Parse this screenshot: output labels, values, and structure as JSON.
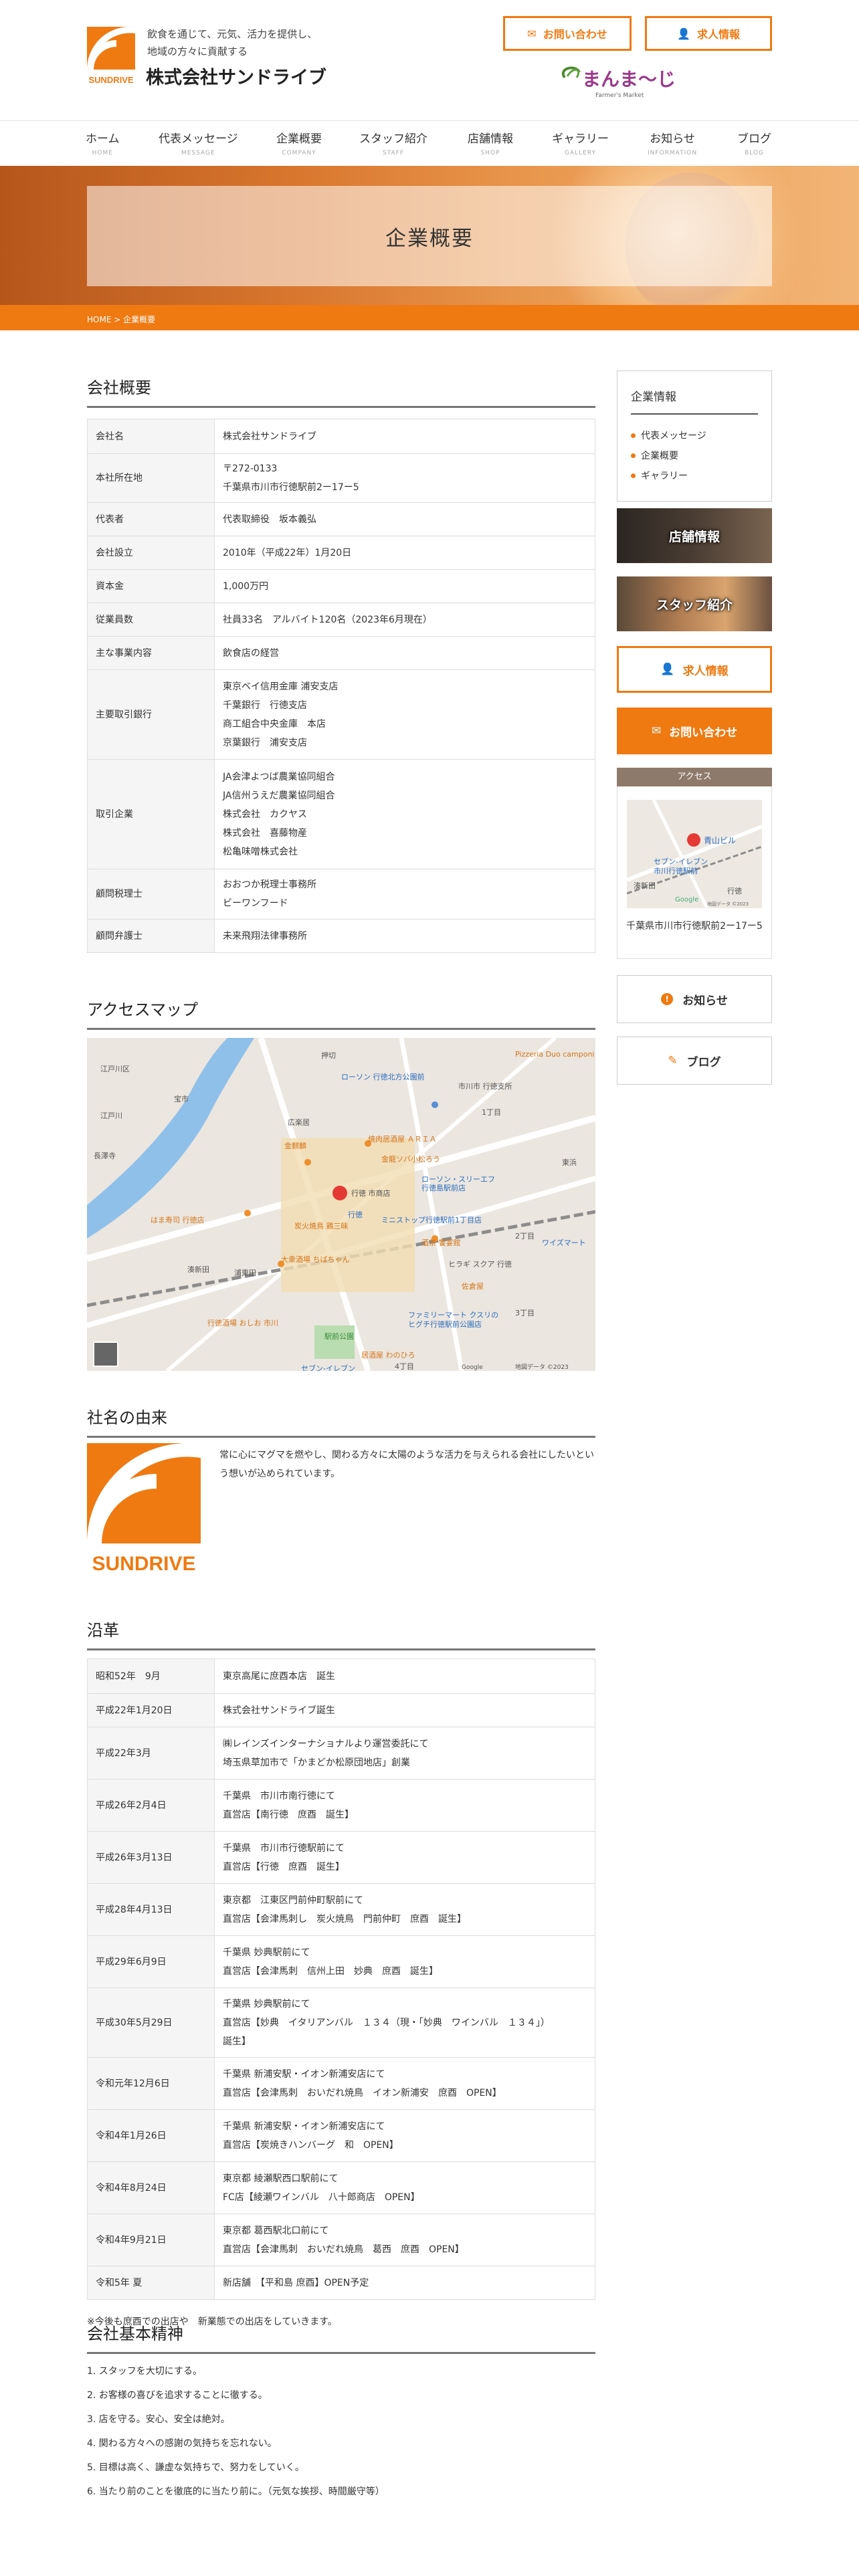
{
  "header": {
    "tagline": [
      "飲食を通じて、元気、活力を提供し、",
      "地域の方々に貢献する"
    ],
    "company_name": "株式会社サンドライブ",
    "logo_text": "SUNDRIVE",
    "contact_button": "お問い合わせ",
    "recruit_button": "求人情報",
    "brand2_text": "まんま〜じゃ",
    "brand2_sub": "Farmer's Market"
  },
  "nav": [
    {
      "jp": "ホーム",
      "en": "HOME"
    },
    {
      "jp": "代表メッセージ",
      "en": "MESSAGE"
    },
    {
      "jp": "企業概要",
      "en": "COMPANY"
    },
    {
      "jp": "スタッフ紹介",
      "en": "STAFF"
    },
    {
      "jp": "店舗情報",
      "en": "SHOP"
    },
    {
      "jp": "ギャラリー",
      "en": "GALLERY"
    },
    {
      "jp": "お知らせ",
      "en": "INFORMATION"
    },
    {
      "jp": "ブログ",
      "en": "BLOG"
    }
  ],
  "hero": {
    "title": "企業概要"
  },
  "breadcrumb": "HOME > 企業概要",
  "overview": {
    "title": "会社概要",
    "rows": [
      {
        "k": "会社名",
        "v": [
          "株式会社サンドライブ"
        ]
      },
      {
        "k": "本社所在地",
        "v": [
          "〒272-0133",
          "千葉県市川市行徳駅前2ー17ー5"
        ]
      },
      {
        "k": "代表者",
        "v": [
          "代表取締役　坂本義弘"
        ]
      },
      {
        "k": "会社設立",
        "v": [
          "2010年（平成22年）1月20日"
        ]
      },
      {
        "k": "資本金",
        "v": [
          "1,000万円"
        ]
      },
      {
        "k": "従業員数",
        "v": [
          "社員33名　アルバイト120名（2023年6月現在）"
        ]
      },
      {
        "k": "主な事業内容",
        "v": [
          "飲食店の経営"
        ]
      },
      {
        "k": "主要取引銀行",
        "v": [
          "東京ベイ信用金庫 浦安支店",
          "千葉銀行　行徳支店",
          "商工組合中央金庫　本店",
          "京葉銀行　浦安支店"
        ]
      },
      {
        "k": "取引企業",
        "v": [
          "JA会津よつば農業協同組合",
          "JA信州うえだ農業協同組合",
          "株式会社　カクヤス",
          "株式会社　喜藤物産",
          "松亀味噌株式会社"
        ]
      },
      {
        "k": "顧問税理士",
        "v": [
          "おおつか税理士事務所",
          "ビーワンフード"
        ]
      },
      {
        "k": "顧問弁護士",
        "v": [
          "未来飛翔法律事務所"
        ]
      }
    ]
  },
  "access_map": {
    "title": "アクセスマップ",
    "labels": [
      "押切",
      "Pizzeria Duo camponi",
      "ローソン 行徳北方公園前",
      "市川市 行徳支所",
      "江戸川区",
      "広楽居",
      "金麒麟",
      "焼肉居酒屋 ＡＲＩＡ",
      "金龍ソバ小松ろう",
      "ローソン・スリーエフ",
      "行徳島駅前店",
      "行徳 市商店",
      "行徳",
      "炭火焼鳥 鶏三昧",
      "ミニストップ行徳駅前1丁目店",
      "はま寿司 行徳店",
      "大衆酒場 ちばちゃん",
      "酒茶 饗宴館",
      "ヒラギ スクア 行徳",
      "ファミリーマート クスリの",
      "ヒグチ行徳駅前公園店",
      "浦東田",
      "駅前公園",
      "ワイズマート",
      "東浜",
      "湊新田",
      "セブン-イレブン",
      "居酒屋 わのひろ",
      "行徳酒場 おしお 市川",
      "佐倉屋",
      "長澤寺",
      "宝市",
      "江戸川",
      "1丁目",
      "2丁目",
      "3丁目",
      "4丁目",
      "Google",
      "地図データ ©2023"
    ]
  },
  "origin": {
    "title": "社名の由来",
    "text": "常に心にマグマを燃やし、関わる方々に太陽のような活力を与えられる会社にしたいという想いが込められています。"
  },
  "history": {
    "title": "沿革",
    "rows": [
      {
        "k": "昭和52年　9月",
        "v": [
          "東京高尾に庶酉本店　誕生"
        ]
      },
      {
        "k": "平成22年1月20日",
        "v": [
          "株式会社サンドライブ誕生"
        ]
      },
      {
        "k": "平成22年3月",
        "v": [
          "㈱レインズインターナショナルより運営委託にて",
          "埼玉県草加市で「かまどか松原団地店」創業"
        ]
      },
      {
        "k": "平成26年2月4日",
        "v": [
          "千葉県　市川市南行徳にて",
          "直営店【南行徳　庶酉　誕生】"
        ]
      },
      {
        "k": "平成26年3月13日",
        "v": [
          "千葉県　市川市行徳駅前にて",
          "直営店【行徳　庶酉　誕生】"
        ]
      },
      {
        "k": "平成28年4月13日",
        "v": [
          "東京都　江東区門前仲町駅前にて",
          "直営店【会津馬刺し　炭火焼鳥　門前仲町　庶酉　誕生】"
        ]
      },
      {
        "k": "平成29年6月9日",
        "v": [
          "千葉県 妙典駅前にて",
          "直営店【会津馬刺　信州上田　妙典　庶酉　誕生】"
        ]
      },
      {
        "k": "平成30年5月29日",
        "v": [
          "千葉県 妙典駅前にて",
          "直営店【妙典　イタリアンバル　１３４（現・「妙典　ワインバル　１３４」）",
          "誕生】"
        ]
      },
      {
        "k": "令和元年12月6日",
        "v": [
          "千葉県 新浦安駅・イオン新浦安店にて",
          "直営店【会津馬刺　おいだれ焼鳥　イオン新浦安　庶酉　OPEN】"
        ]
      },
      {
        "k": "令和4年1月26日",
        "v": [
          "千葉県 新浦安駅・イオン新浦安店にて",
          "直営店【炭焼きハンバーグ　和　OPEN】"
        ]
      },
      {
        "k": "令和4年8月24日",
        "v": [
          "東京都 綾瀬駅西口駅前にて",
          "FC店【綾瀬ワインバル　八十郎商店　OPEN】"
        ]
      },
      {
        "k": "令和4年9月21日",
        "v": [
          "東京都 葛西駅北口前にて",
          "直営店【会津馬刺　おいだれ焼鳥　葛西　庶酉　OPEN】"
        ]
      },
      {
        "k": "令和5年 夏",
        "v": [
          "新店舗　【平和島 庶酉】OPEN予定"
        ]
      }
    ],
    "note": "※今後も庶酉での出店や　新業態での出店をしていきます。"
  },
  "spirit": {
    "title": "会社基本精神",
    "items": [
      "1. スタッフを大切にする。",
      "2. お客様の喜びを追求することに徹する。",
      "3. 店を守る。安心、安全は絶対。",
      "4. 関わる方々への感謝の気持ちを忘れない。",
      "5. 目標は高く、謙虚な気持ちで、努力をしていく。",
      "6. 当たり前のことを徹底的に当たり前に。（元気な挨拶、時間厳守等）"
    ]
  },
  "sidebar": {
    "card_title": "企業情報",
    "links": [
      "代表メッセージ",
      "企業概要",
      "ギャラリー"
    ],
    "banner_shop": "店舗情報",
    "banner_staff": "スタッフ紹介",
    "recruit": "求人情報",
    "contact": "お問い合わせ",
    "access_title": "アクセス",
    "access_map_labels": [
      "青山ビル",
      "セブン-イレブン",
      "市川行徳駅前",
      "湊新田",
      "行徳",
      "Google",
      "地図データ ©2023"
    ],
    "access_address": "千葉県市川市行徳駅前2ー17ー5",
    "news": "お知らせ",
    "blog": "ブログ"
  },
  "colors": {
    "accent": "#ef7a12",
    "brown": "#8e7a6b",
    "green": "#4c8b2e"
  }
}
